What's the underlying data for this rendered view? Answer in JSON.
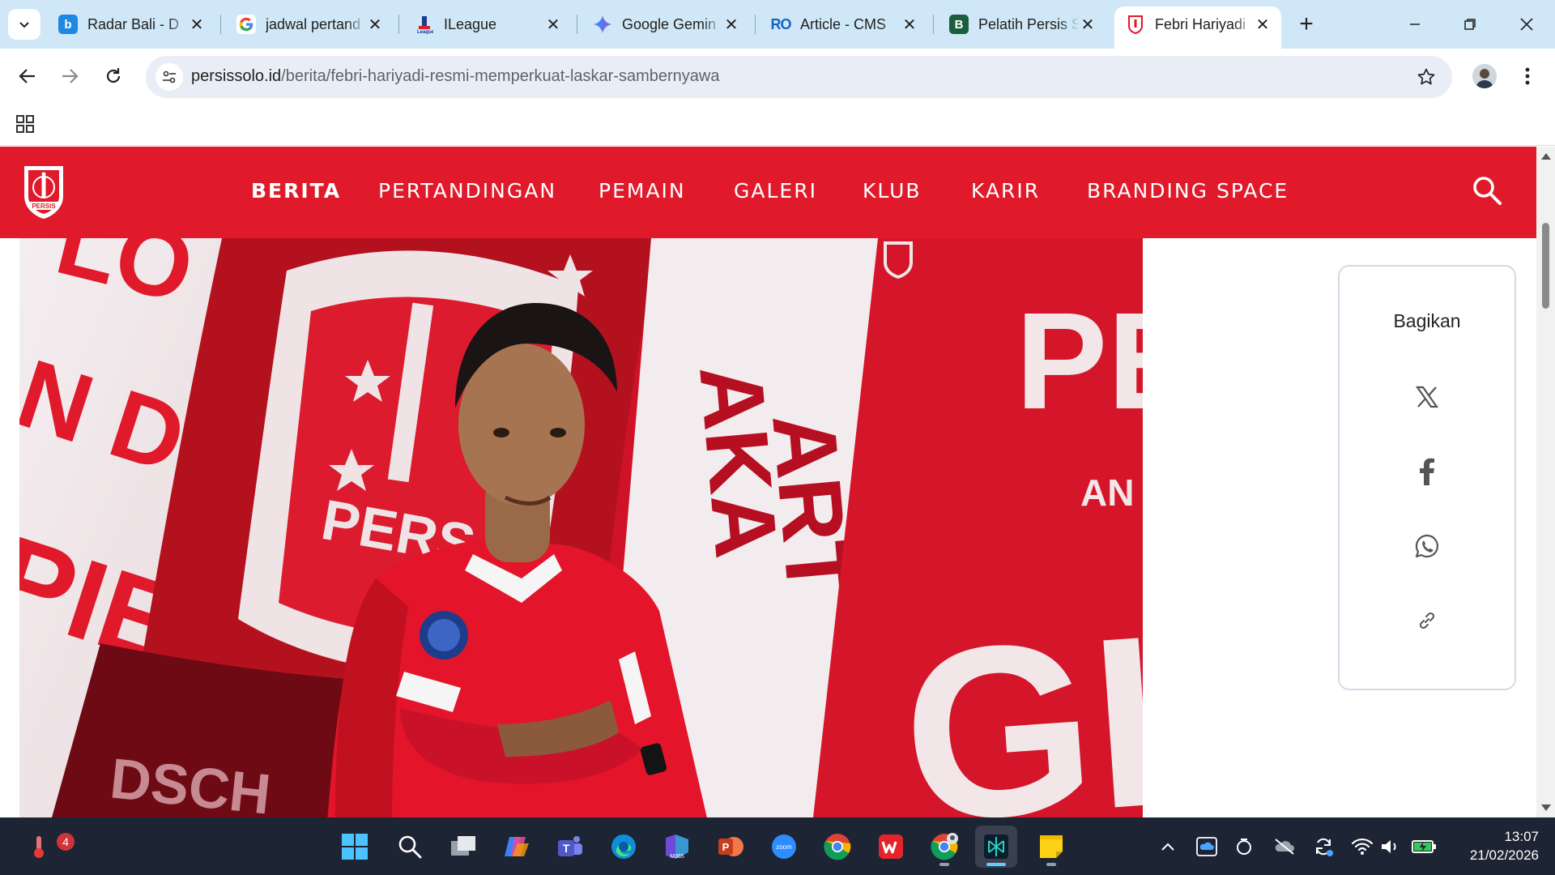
{
  "browser": {
    "tabs": [
      {
        "title": "Radar Bali - D",
        "favicon": "radar-bali-icon",
        "color": "#1e88e5"
      },
      {
        "title": "jadwal pertand",
        "favicon": "google-icon",
        "color": "#4285f4"
      },
      {
        "title": "ILeague",
        "favicon": "ileague-icon",
        "color": "#1a3d8f"
      },
      {
        "title": "Google Gemin",
        "favicon": "gemini-icon",
        "color": "#4f7df3"
      },
      {
        "title": "Article - CMS",
        "favicon": "cms-icon",
        "color": "#1565c0"
      },
      {
        "title": "Pelatih Persis S",
        "favicon": "b-icon",
        "color": "#1b5e3f"
      },
      {
        "title": "Febri Hariyadi",
        "favicon": "persis-icon",
        "color": "#e01a2b"
      }
    ],
    "active_tab": 6,
    "url_domain": "persissolo.id",
    "url_path": "/berita/febri-hariyadi-resmi-memperkuat-laskar-sambernyawa"
  },
  "site": {
    "brand_color": "#e01a2b",
    "logo_text": "PERSIS",
    "nav": [
      {
        "label": "BERITA",
        "active": true
      },
      {
        "label": "PERTANDINGAN",
        "active": false
      },
      {
        "label": "PEMAIN",
        "active": false
      },
      {
        "label": "GALERI",
        "active": false
      },
      {
        "label": "KLUB",
        "active": false
      },
      {
        "label": "KARIR",
        "active": false
      },
      {
        "label": "BRANDING SPACE",
        "active": false
      }
    ]
  },
  "hero": {
    "banner_texts": [
      "LO",
      "N DE",
      "PIE",
      "PERS",
      "AKA",
      "ART",
      "PE",
      "AN",
      "GIO",
      "DSCH"
    ]
  },
  "share": {
    "title": "Bagikan",
    "buttons": [
      "x-icon",
      "facebook-icon",
      "whatsapp-icon",
      "link-icon"
    ]
  },
  "taskbar": {
    "weather_badge": "4",
    "time": "13:07",
    "date": "21/02/2026"
  }
}
